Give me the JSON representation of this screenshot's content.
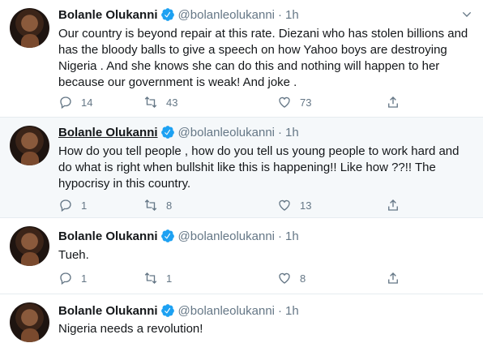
{
  "tweets": [
    {
      "name": "Bolanle Olukanni",
      "handle": "@bolanleolukanni",
      "time": "1h",
      "text": "Our country is beyond repair at this rate. Diezani who has stolen billions and has the bloody balls to give a speech on how Yahoo boys are destroying Nigeria . And she knows she can do this and nothing will happen to her because our government is weak! And joke .",
      "replies": "14",
      "retweets": "43",
      "likes": "73"
    },
    {
      "name": "Bolanle Olukanni",
      "handle": "@bolanleolukanni",
      "time": "1h",
      "text": "How do you tell people , how do you tell us young people to work hard and do what is right when bullshit like this is happening!! Like how ??!! The hypocrisy in this country.",
      "replies": "1",
      "retweets": "8",
      "likes": "13"
    },
    {
      "name": "Bolanle Olukanni",
      "handle": "@bolanleolukanni",
      "time": "1h",
      "text": "Tueh.",
      "replies": "1",
      "retweets": "1",
      "likes": "8"
    },
    {
      "name": "Bolanle Olukanni",
      "handle": "@bolanleolukanni",
      "time": "1h",
      "text": "Nigeria needs a revolution!"
    }
  ],
  "icons": {
    "verified": "verified-badge-icon",
    "reply": "reply-icon",
    "retweet": "retweet-icon",
    "like": "heart-icon",
    "share": "share-icon",
    "more": "chevron-down-icon"
  },
  "colors": {
    "verified": "#1da1f2",
    "muted": "#657786",
    "hover_bg": "#f5f8fa"
  }
}
